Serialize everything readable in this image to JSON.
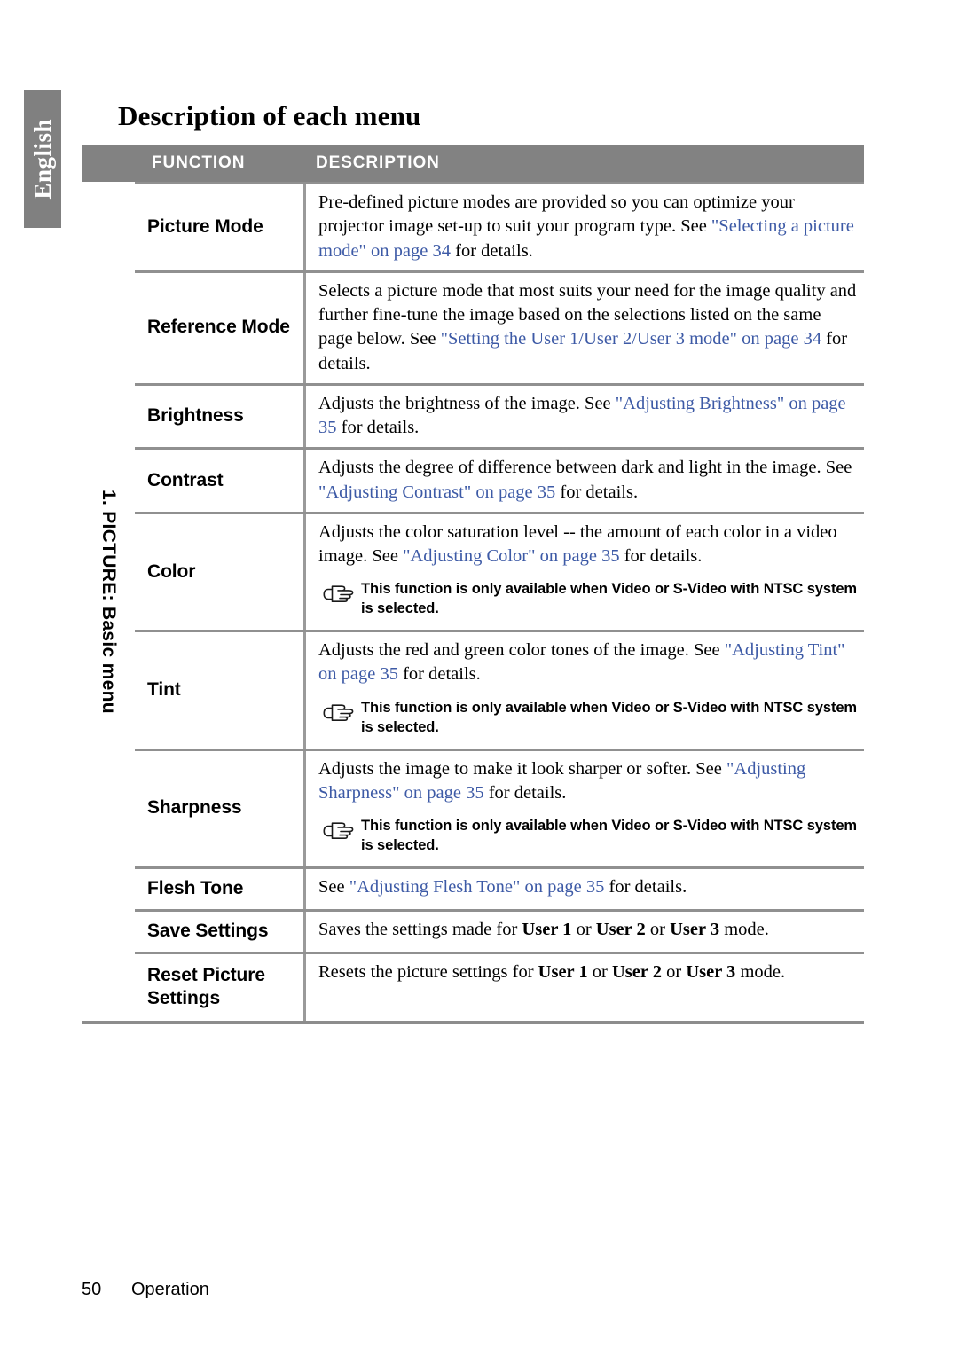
{
  "language_tab": {
    "label": "English"
  },
  "page_title": "Description of each menu",
  "table": {
    "headers": {
      "function": "FUNCTION",
      "description": "DESCRIPTION"
    },
    "group_label": "1. PICTURE: Basic menu",
    "note_icon": "pointing-hand-icon",
    "note_text": "This function is only available when Video or S-Video with NTSC system is selected.",
    "rows": [
      {
        "function": "Picture Mode",
        "description_parts": [
          {
            "text": "Pre-defined picture modes are provided so you can optimize your projector image set-up to suit your program type. See ",
            "style": "plain"
          },
          {
            "text": "\"Selecting a picture mode\" on page 34",
            "style": "link"
          },
          {
            "text": " for details.",
            "style": "plain"
          }
        ],
        "has_note": false
      },
      {
        "function": "Reference Mode",
        "description_parts": [
          {
            "text": "Selects a picture mode that most suits your need for the image quality and further fine-tune the image based on the selections listed on the same page below. See ",
            "style": "plain"
          },
          {
            "text": "\"Setting the User 1/User 2/User 3 mode\" on page 34",
            "style": "link"
          },
          {
            "text": " for details.",
            "style": "plain"
          }
        ],
        "has_note": false
      },
      {
        "function": "Brightness",
        "description_parts": [
          {
            "text": "Adjusts the brightness of the image. See ",
            "style": "plain"
          },
          {
            "text": "\"Adjusting Brightness\" on page 35",
            "style": "link"
          },
          {
            "text": " for details.",
            "style": "plain"
          }
        ],
        "has_note": false
      },
      {
        "function": "Contrast",
        "description_parts": [
          {
            "text": "Adjusts the degree of difference between dark and light in the image. See ",
            "style": "plain"
          },
          {
            "text": "\"Adjusting Contrast\" on page 35",
            "style": "link"
          },
          {
            "text": " for details.",
            "style": "plain"
          }
        ],
        "has_note": false
      },
      {
        "function": "Color",
        "description_parts": [
          {
            "text": "Adjusts the color saturation level -- the amount of each color in a video image. See ",
            "style": "plain"
          },
          {
            "text": "\"Adjusting Color\" on page 35",
            "style": "link"
          },
          {
            "text": " for details.",
            "style": "plain"
          }
        ],
        "has_note": true
      },
      {
        "function": "Tint",
        "description_parts": [
          {
            "text": "Adjusts the red and green color tones of the image. See ",
            "style": "plain"
          },
          {
            "text": "\"Adjusting Tint\" on page 35",
            "style": "link"
          },
          {
            "text": " for details.",
            "style": "plain"
          }
        ],
        "has_note": true
      },
      {
        "function": "Sharpness",
        "description_parts": [
          {
            "text": "Adjusts the image to make it look sharper or softer. See ",
            "style": "plain"
          },
          {
            "text": "\"Adjusting Sharpness\" on page 35",
            "style": "link"
          },
          {
            "text": " for details.",
            "style": "plain"
          }
        ],
        "has_note": true
      },
      {
        "function": "Flesh Tone",
        "description_parts": [
          {
            "text": "See ",
            "style": "plain"
          },
          {
            "text": "\"Adjusting Flesh Tone\" on page 35",
            "style": "link"
          },
          {
            "text": " for details.",
            "style": "plain"
          }
        ],
        "has_note": false
      },
      {
        "function": "Save Settings",
        "description_parts": [
          {
            "text": "Saves the settings made for ",
            "style": "plain"
          },
          {
            "text": "User 1",
            "style": "bold"
          },
          {
            "text": " or ",
            "style": "plain"
          },
          {
            "text": "User 2",
            "style": "bold"
          },
          {
            "text": " or ",
            "style": "plain"
          },
          {
            "text": "User 3",
            "style": "bold"
          },
          {
            "text": " mode.",
            "style": "plain"
          }
        ],
        "has_note": false
      },
      {
        "function": "Reset Picture Settings",
        "description_parts": [
          {
            "text": "Resets the picture settings for ",
            "style": "plain"
          },
          {
            "text": "User 1",
            "style": "bold"
          },
          {
            "text": " or ",
            "style": "plain"
          },
          {
            "text": "User 2",
            "style": "bold"
          },
          {
            "text": " or ",
            "style": "plain"
          },
          {
            "text": "User 3",
            "style": "bold"
          },
          {
            "text": " mode.",
            "style": "plain"
          }
        ],
        "has_note": false
      }
    ]
  },
  "footer": {
    "page_number": "50",
    "section": "Operation"
  },
  "colors": {
    "header_bar": "#828282",
    "language_tab": "#808080",
    "link": "#3d5aa6",
    "rule": "#909090"
  }
}
